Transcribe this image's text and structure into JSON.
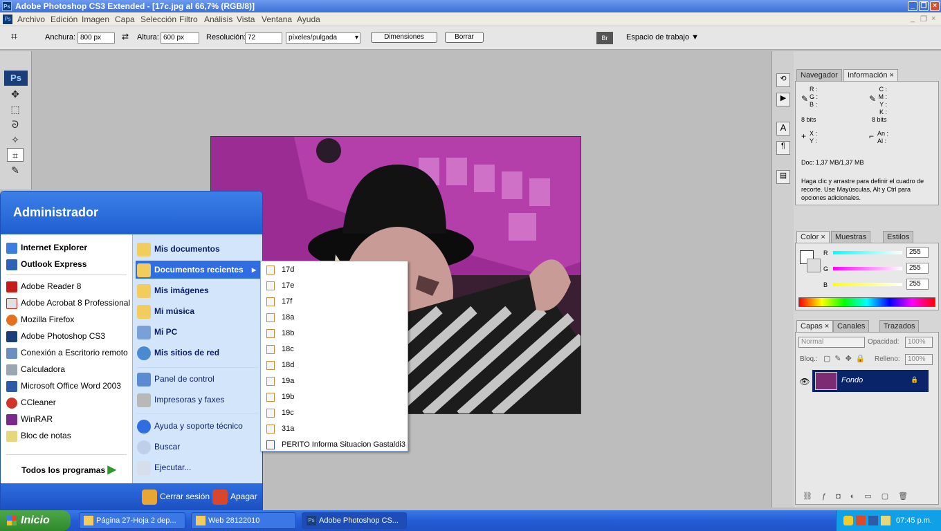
{
  "window": {
    "title": "Adobe Photoshop CS3 Extended - [17c.jpg al 66,7% (RGB/8)]",
    "ps_badge": "Ps"
  },
  "menus": [
    "Archivo",
    "Edición",
    "Imagen",
    "Capa",
    "Selección",
    "Filtro",
    "Análisis",
    "Vista",
    "Ventana",
    "Ayuda"
  ],
  "options": {
    "width_label": "Anchura:",
    "width_value": "800 px",
    "height_label": "Altura:",
    "height_value": "600 px",
    "res_label": "Resolución:",
    "res_value": "72",
    "res_unit": "píxeles/pulgada",
    "dims_btn": "Dimensiones",
    "clear_btn": "Borrar",
    "workspace": "Espacio de trabajo"
  },
  "nav_panel": {
    "tabs": [
      "Navegador",
      "Información"
    ],
    "r": "R :",
    "g": "G :",
    "b": "B :",
    "c": "C :",
    "m": "M :",
    "y": "Y :",
    "k": "K :",
    "bits1": "8 bits",
    "bits2": "8 bits",
    "x": "X :",
    "yy": "Y :",
    "an": "An :",
    "al": "Al :",
    "doc": "Doc: 1,37 MB/1,37 MB",
    "hint": "Haga clic y arrastre para definir el cuadro de recorte. Use Mayúsculas, Alt y Ctrl para opciones adicionales."
  },
  "color_panel": {
    "tabs": [
      "Color",
      "Muestras",
      "Estilos"
    ],
    "r_label": "R",
    "g_label": "G",
    "b_label": "B",
    "r": "255",
    "g": "255",
    "b": "255"
  },
  "layers_panel": {
    "tabs": [
      "Capas",
      "Canales",
      "Trazados"
    ],
    "mode": "Normal",
    "opacity_label": "Opacidad:",
    "opacity": "100%",
    "lock_label": "Bloq.:",
    "fill_label": "Relleno:",
    "fill": "100%",
    "layer_name": "Fondo"
  },
  "start_menu": {
    "user": "Administrador",
    "pinned": [
      {
        "label": "Internet Explorer",
        "bold": true
      },
      {
        "label": "Outlook Express",
        "bold": true
      }
    ],
    "recent": [
      "Adobe Reader 8",
      "Adobe Acrobat 8 Professional",
      "Mozilla Firefox",
      "Adobe Photoshop CS3",
      "Conexión a Escritorio remoto",
      "Calculadora",
      "Microsoft Office Word 2003",
      "CCleaner",
      "WinRAR",
      "Bloc de notas"
    ],
    "all_programs": "Todos los programas",
    "right": [
      "Mis documentos",
      "Documentos recientes",
      "Mis imágenes",
      "Mi música",
      "Mi PC",
      "Mis sitios de red",
      "Panel de control",
      "Impresoras y faxes",
      "Ayuda y soporte técnico",
      "Buscar",
      "Ejecutar..."
    ],
    "logoff": "Cerrar sesión",
    "shutdown": "Apagar"
  },
  "recent_docs": [
    "17d",
    "17e",
    "17f",
    "18a",
    "18b",
    "18c",
    "18d",
    "19a",
    "19b",
    "19c",
    "31a",
    "PERITO Informa Situacion Gastaldi3"
  ],
  "taskbar": {
    "start": "Inicio",
    "tasks": [
      "Página 27-Hoja 2 dep...",
      "Web 28122010",
      "Adobe Photoshop CS..."
    ],
    "clock": "07:45 p.m."
  },
  "colors": {
    "xp_blue": "#245dd6",
    "start_green": "#2f8a2c",
    "layer_sel": "#0a246a"
  }
}
